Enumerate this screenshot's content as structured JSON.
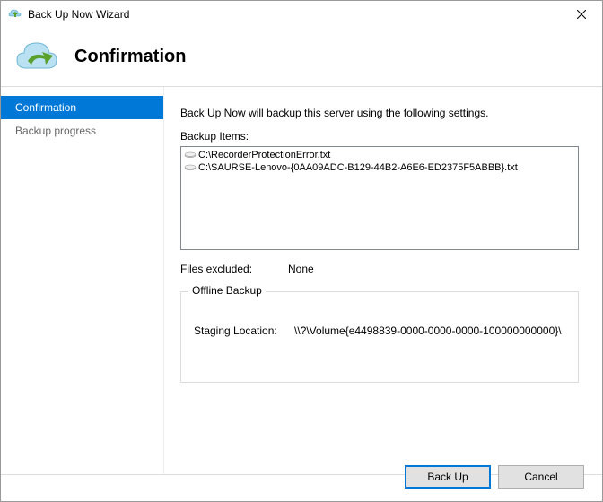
{
  "window": {
    "title": "Back Up Now Wizard"
  },
  "header": {
    "title": "Confirmation"
  },
  "sidebar": {
    "items": [
      {
        "label": "Confirmation",
        "active": true
      },
      {
        "label": "Backup progress",
        "active": false
      }
    ]
  },
  "main": {
    "intro": "Back Up Now will backup this server using the following settings.",
    "backup_items_label": "Backup Items:",
    "backup_items": [
      "C:\\RecorderProtectionError.txt",
      "C:\\SAURSE-Lenovo-{0AA09ADC-B129-44B2-A6E6-ED2375F5ABBB}.txt"
    ],
    "files_excluded_label": "Files excluded:",
    "files_excluded_value": "None",
    "offline_backup_label": "Offline Backup",
    "staging_label": "Staging Location:",
    "staging_value": "\\\\?\\Volume{e4498839-0000-0000-0000-100000000000}\\"
  },
  "buttons": {
    "primary": "Back Up",
    "cancel": "Cancel"
  }
}
